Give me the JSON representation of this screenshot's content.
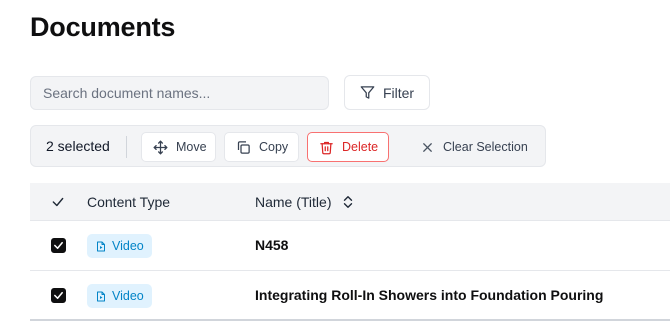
{
  "page": {
    "title": "Documents"
  },
  "search": {
    "placeholder": "Search document names..."
  },
  "toolbar": {
    "filter_label": "Filter"
  },
  "bulk": {
    "selected_text": "2 selected",
    "move_label": "Move",
    "copy_label": "Copy",
    "delete_label": "Delete",
    "clear_label": "Clear Selection"
  },
  "table": {
    "columns": {
      "content_type": "Content Type",
      "name": "Name (Title)"
    },
    "rows": [
      {
        "checked": true,
        "type": "Video",
        "name": "N458"
      },
      {
        "checked": true,
        "type": "Video",
        "name": "Integrating Roll-In Showers into Foundation Pouring"
      }
    ]
  },
  "colors": {
    "delete": "#dc2626",
    "badge_bg": "#e0f2fe",
    "badge_text": "#0284c7"
  },
  "icons": [
    "filter-icon",
    "move-icon",
    "copy-icon",
    "trash-icon",
    "close-icon",
    "sort-icon",
    "file-icon",
    "check-icon"
  ]
}
